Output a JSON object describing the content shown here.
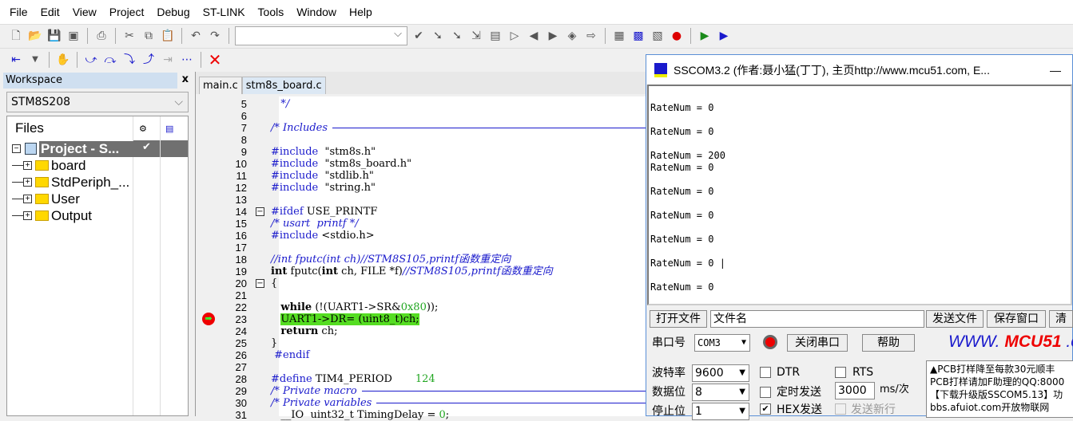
{
  "menu": [
    "File",
    "Edit",
    "View",
    "Project",
    "Debug",
    "ST-LINK",
    "Tools",
    "Window",
    "Help"
  ],
  "workspace": {
    "title": "Workspace",
    "close": "x",
    "config": "STM8S208",
    "files_header": "Files",
    "check": "✔",
    "tree": [
      {
        "label": "Project - S...",
        "type": "project"
      },
      {
        "label": "board",
        "type": "folder"
      },
      {
        "label": "StdPeriph_...",
        "type": "folder"
      },
      {
        "label": "User",
        "type": "folder"
      },
      {
        "label": "Output",
        "type": "folder"
      }
    ]
  },
  "editor": {
    "tabs": [
      "main.c",
      "stm8s_board.c"
    ],
    "active_tab": 1,
    "current_line": 23,
    "lines": [
      {
        "n": "5",
        "s": [
          [
            "cm",
            "   */"
          ]
        ]
      },
      {
        "n": "6",
        "s": []
      },
      {
        "n": "7",
        "s": [
          [
            "cm",
            "/* Includes"
          ]
        ],
        "rule": true
      },
      {
        "n": "8",
        "s": []
      },
      {
        "n": "9",
        "s": [
          [
            "kw",
            "#include"
          ],
          [
            "",
            "  \"stm8s.h\""
          ]
        ]
      },
      {
        "n": "10",
        "s": [
          [
            "kw",
            "#include"
          ],
          [
            "",
            "  \"stm8s_board.h\""
          ]
        ]
      },
      {
        "n": "11",
        "s": [
          [
            "kw",
            "#include"
          ],
          [
            "",
            "  \"stdlib.h\""
          ]
        ]
      },
      {
        "n": "12",
        "s": [
          [
            "kw",
            "#include"
          ],
          [
            "",
            "  \"string.h\""
          ]
        ]
      },
      {
        "n": "13",
        "s": []
      },
      {
        "n": "14",
        "s": [
          [
            "kw",
            "#ifdef"
          ],
          [
            "",
            " USE_PRINTF"
          ]
        ]
      },
      {
        "n": "15",
        "s": [
          [
            "cm",
            "/* usart  printf */"
          ]
        ]
      },
      {
        "n": "16",
        "s": [
          [
            "kw",
            "#include"
          ],
          [
            "",
            " <stdio.h>"
          ]
        ]
      },
      {
        "n": "17",
        "s": []
      },
      {
        "n": "18",
        "s": [
          [
            "cm",
            "//int fputc(int ch)//STM8S105,printf函数重定向"
          ]
        ]
      },
      {
        "n": "19",
        "s": [
          [
            "b",
            "int"
          ],
          [
            "",
            " fputc("
          ],
          [
            "b",
            "int"
          ],
          [
            "",
            " ch, FILE *f)"
          ],
          [
            "cm",
            "//STM8S105,printf函数重定向"
          ]
        ]
      },
      {
        "n": "20",
        "s": [
          [
            "",
            "{"
          ]
        ]
      },
      {
        "n": "21",
        "s": []
      },
      {
        "n": "22",
        "s": [
          [
            "",
            "   "
          ],
          [
            "b",
            "while"
          ],
          [
            "",
            " (!(UART1->SR&"
          ],
          [
            "num",
            "0x80"
          ],
          [
            "",
            "));"
          ]
        ]
      },
      {
        "n": "23",
        "s": [
          [
            "",
            "   "
          ],
          [
            "hl",
            "UART1->DR= (uint8_t)ch;"
          ]
        ]
      },
      {
        "n": "24",
        "s": [
          [
            "",
            "   "
          ],
          [
            "b",
            "return"
          ],
          [
            "",
            " ch;"
          ]
        ]
      },
      {
        "n": "25",
        "s": [
          [
            "",
            "}"
          ]
        ]
      },
      {
        "n": "26",
        "s": [
          [
            "kw",
            " #endif"
          ]
        ]
      },
      {
        "n": "27",
        "s": []
      },
      {
        "n": "28",
        "s": [
          [
            "kw",
            "#define"
          ],
          [
            "",
            " TIM4_PERIOD       "
          ],
          [
            "num",
            "124"
          ]
        ]
      },
      {
        "n": "29",
        "s": [
          [
            "cm",
            "/* Private macro"
          ]
        ],
        "rule": true
      },
      {
        "n": "30",
        "s": [
          [
            "cm",
            "/* Private variables"
          ]
        ],
        "rule": true
      },
      {
        "n": "31",
        "s": [
          [
            "",
            "   __IO  uint32_t TimingDelay = "
          ],
          [
            "num",
            "0"
          ],
          [
            "",
            ";"
          ]
        ]
      }
    ]
  },
  "sscom": {
    "title": "SSCOM3.2 (作者:聂小猛(丁丁), 主页http://www.mcu51.com,  E...",
    "minimize": "—",
    "receive": [
      "RateNum = 0",
      "",
      "RateNum = 0",
      "",
      "RateNum = 200",
      "RateNum = 0",
      "",
      "RateNum = 0",
      "",
      "RateNum = 0",
      "",
      "RateNum = 0",
      "",
      "RateNum = 0 |",
      "",
      "RateNum = 0"
    ],
    "open_file": "打开文件",
    "file_name": "文件名",
    "send_file": "发送文件",
    "save_window": "保存窗口",
    "clear": "清",
    "port_label": "串口号",
    "port": "COM3",
    "close_port": "关闭串口",
    "help": "帮助",
    "brand": "WWW.",
    "brand2": "MCU51",
    ".c": ".c",
    "baud_label": "波特率",
    "baud": "9600",
    "data_label": "数据位",
    "data_bits": "8",
    "stop_label": "停止位",
    "stop_bits": "1",
    "dtr": "DTR",
    "rts": "RTS",
    "timed_send": "定时发送",
    "interval": "3000",
    "interval_unit": "ms/次",
    "hex_send": "HEX发送",
    "send_newline": "发送新行",
    "hex_checked": true,
    "ad": [
      "▲PCB打样降至每款30元顺丰",
      "PCB打样请加F助理的QQ:8000",
      "【下载升级版SSCOM5.13】功",
      "bbs.afuiot.com开放物联网"
    ]
  }
}
